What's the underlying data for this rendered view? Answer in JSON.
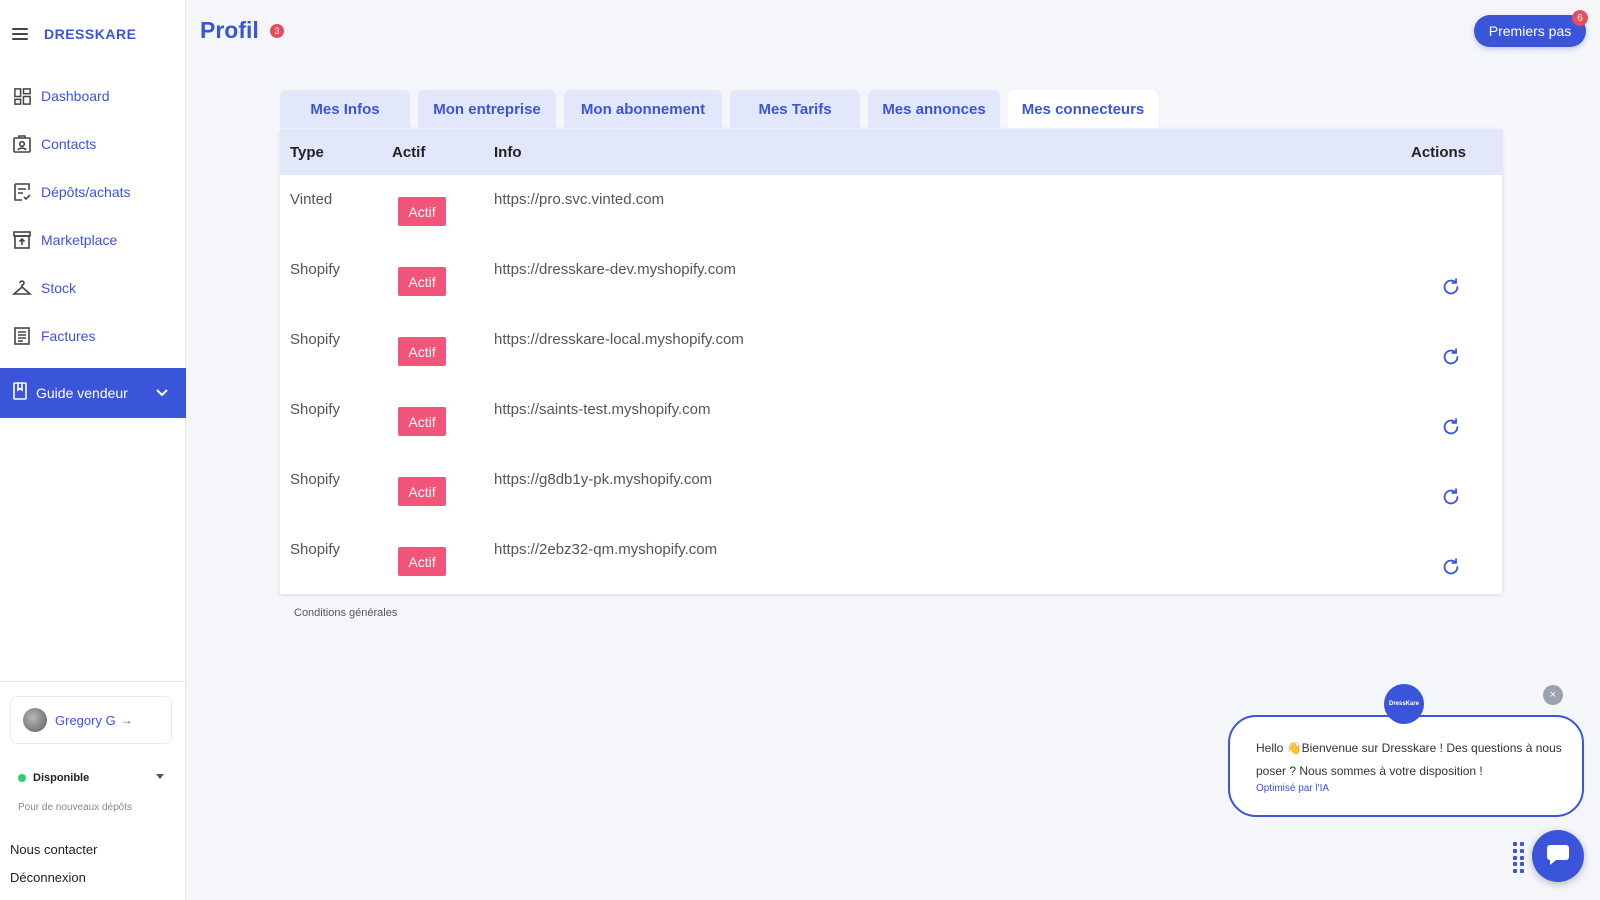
{
  "sidebar": {
    "brand": "DRESSKARE",
    "items": [
      {
        "label": "Dashboard",
        "icon": "grid-icon"
      },
      {
        "label": "Contacts",
        "icon": "contact-card-icon"
      },
      {
        "label": "Dépôts/achats",
        "icon": "receipt-icon"
      },
      {
        "label": "Marketplace",
        "icon": "store-icon"
      },
      {
        "label": "Stock",
        "icon": "hanger-icon"
      },
      {
        "label": "Factures",
        "icon": "invoice-icon"
      }
    ],
    "guide": {
      "label": "Guide vendeur",
      "icon": "book-icon"
    },
    "user": {
      "name": "Gregory G",
      "arrow": "→"
    },
    "status": {
      "label": "Disponible",
      "sub": "Pour de nouveaux dépôts"
    },
    "contact": "Nous contacter",
    "logout": "Déconnexion"
  },
  "header": {
    "title": "Profil",
    "title_badge": "3",
    "premiers_pas": "Premiers pas",
    "premiers_badge": "6"
  },
  "tabs": [
    {
      "label": "Mes Infos",
      "active": false
    },
    {
      "label": "Mon entreprise",
      "active": false
    },
    {
      "label": "Mon abonnement",
      "active": false
    },
    {
      "label": "Mes Tarifs",
      "active": false
    },
    {
      "label": "Mes annonces",
      "active": false
    },
    {
      "label": "Mes connecteurs",
      "active": true
    }
  ],
  "table": {
    "headers": {
      "type": "Type",
      "actif": "Actif",
      "info": "Info",
      "actions": "Actions"
    },
    "rows": [
      {
        "type": "Vinted",
        "actif": "Actif",
        "info": "https://pro.svc.vinted.com",
        "refresh": false
      },
      {
        "type": "Shopify",
        "actif": "Actif",
        "info": "https://dresskare-dev.myshopify.com",
        "refresh": true
      },
      {
        "type": "Shopify",
        "actif": "Actif",
        "info": "https://dresskare-local.myshopify.com",
        "refresh": true
      },
      {
        "type": "Shopify",
        "actif": "Actif",
        "info": "https://saints-test.myshopify.com",
        "refresh": true
      },
      {
        "type": "Shopify",
        "actif": "Actif",
        "info": "https://g8db1y-pk.myshopify.com",
        "refresh": true
      },
      {
        "type": "Shopify",
        "actif": "Actif",
        "info": "https://2ebz32-qm.myshopify.com",
        "refresh": true
      }
    ]
  },
  "footer": {
    "conditions": "Conditions générales"
  },
  "chat": {
    "logo": "DressKare",
    "message": "Hello 👋Bienvenue sur Dresskare ! Des questions à nous poser ? Nous sommes à votre disposition !",
    "sub": "Optimisé par l'IA",
    "close": "×"
  },
  "colors": {
    "brand": "#3a55d9",
    "badge": "#f2557a",
    "tab_bg": "#e3e7fb",
    "notification": "#e74c5c"
  }
}
